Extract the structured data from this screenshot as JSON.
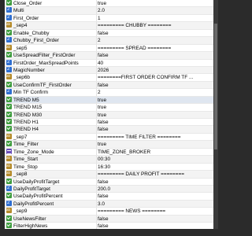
{
  "params": [
    {
      "name": "Close_Order",
      "value": "true",
      "icon": "bool-icon"
    },
    {
      "name": "Multi",
      "value": "2.0",
      "icon": "num-icon"
    },
    {
      "name": "First_Order",
      "value": "1",
      "icon": "num-icon"
    },
    {
      "name": "_sep4",
      "value": "========= CHUBBY ========",
      "icon": "str-icon"
    },
    {
      "name": "Enable_Chubby",
      "value": "false",
      "icon": "bool-icon"
    },
    {
      "name": "Chubby_First_Order",
      "value": "2",
      "icon": "num-icon"
    },
    {
      "name": "_sep5",
      "value": "========= SPREAD ========",
      "icon": "str-icon"
    },
    {
      "name": "UseSpreadFilter_FirstOrder",
      "value": "false",
      "icon": "bool-icon"
    },
    {
      "name": "FirstOrder_MaxSpreadPoints",
      "value": "40",
      "icon": "num-icon"
    },
    {
      "name": "MagicNumber",
      "value": "2026",
      "icon": "num-icon"
    },
    {
      "name": "_sep6b",
      "value": "========FIRST ORDER CONFIRM TF ...",
      "icon": "str-icon"
    },
    {
      "name": "UseConfirmTF_FirstOrder",
      "value": "false",
      "icon": "bool-icon"
    },
    {
      "name": "Min TF Confirm",
      "value": "2",
      "icon": "num-icon"
    },
    {
      "name": "TREND M5",
      "value": "true",
      "icon": "bool-icon"
    },
    {
      "name": "TREND M15",
      "value": "true",
      "icon": "bool-icon"
    },
    {
      "name": "TREND M30",
      "value": "true",
      "icon": "bool-icon"
    },
    {
      "name": "TREND H1",
      "value": "false",
      "icon": "bool-icon"
    },
    {
      "name": "TREND H4",
      "value": "false",
      "icon": "bool-icon"
    },
    {
      "name": "_sep7",
      "value": "========= TIME FILTER ========",
      "icon": "str-icon"
    },
    {
      "name": "Time_Filter",
      "value": "true",
      "icon": "bool-icon"
    },
    {
      "name": "Time_Zone_Mode",
      "value": "TIME_ZONE_BROKER",
      "icon": "enum-icon"
    },
    {
      "name": "Time_Start",
      "value": "00:30",
      "icon": "str-icon"
    },
    {
      "name": "Time_Stop",
      "value": "16:30",
      "icon": "str-icon"
    },
    {
      "name": "_sep8",
      "value": "========= DAILY PROFIT ========",
      "icon": "str-icon"
    },
    {
      "name": "UseDailyProfitTarget",
      "value": "false",
      "icon": "bool-icon"
    },
    {
      "name": "DailyProfitTarget",
      "value": "200.0",
      "icon": "num-icon"
    },
    {
      "name": "UseDailyProfitPercent",
      "value": "false",
      "icon": "bool-icon"
    },
    {
      "name": "DailyProfitPercent",
      "value": "3.0",
      "icon": "num-icon"
    },
    {
      "name": "_sep9",
      "value": "========= NEWS ========",
      "icon": "str-icon"
    },
    {
      "name": "UseNewsFilter",
      "value": "false",
      "icon": "bool-icon"
    },
    {
      "name": "FilterHighNews",
      "value": "false",
      "icon": "bool-icon"
    }
  ]
}
